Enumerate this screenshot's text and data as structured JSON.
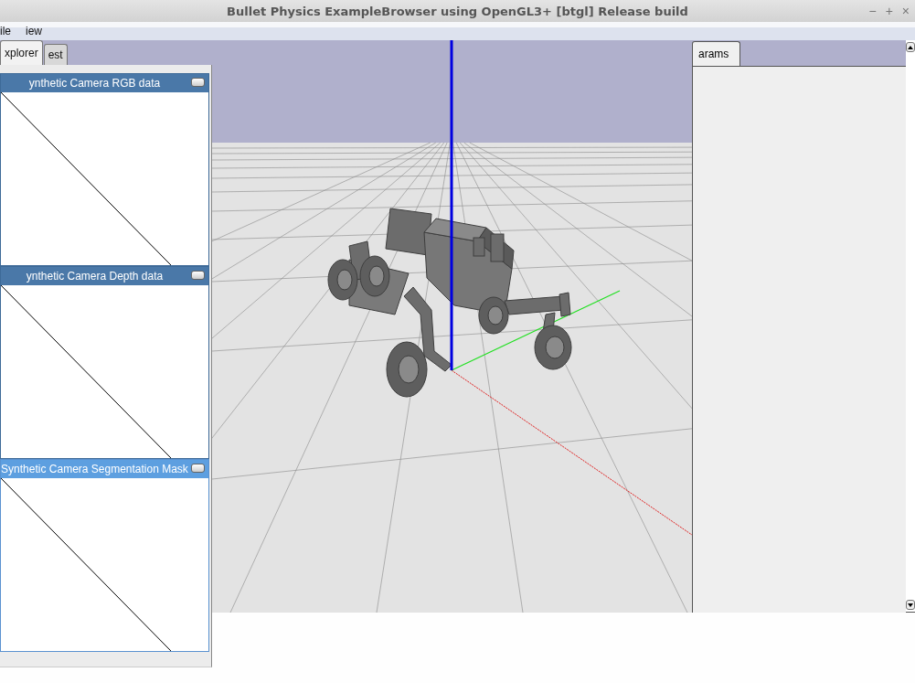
{
  "window": {
    "title": "Bullet Physics ExampleBrowser using OpenGL3+ [btgl] Release build",
    "controls": [
      "−",
      "+",
      "×"
    ]
  },
  "menu": [
    "ile",
    "iew"
  ],
  "explorer_tabs": [
    {
      "label": "xplorer",
      "selected": true
    },
    {
      "label": "est",
      "selected": false
    }
  ],
  "camera_windows": [
    {
      "title": "ynthetic Camera RGB data",
      "selected": false
    },
    {
      "title": "ynthetic Camera Depth data",
      "selected": false
    },
    {
      "title": "Synthetic Camera Segmentation Mask",
      "selected": true
    }
  ],
  "params_tabs": [
    {
      "label": "arams",
      "selected": true
    }
  ]
}
